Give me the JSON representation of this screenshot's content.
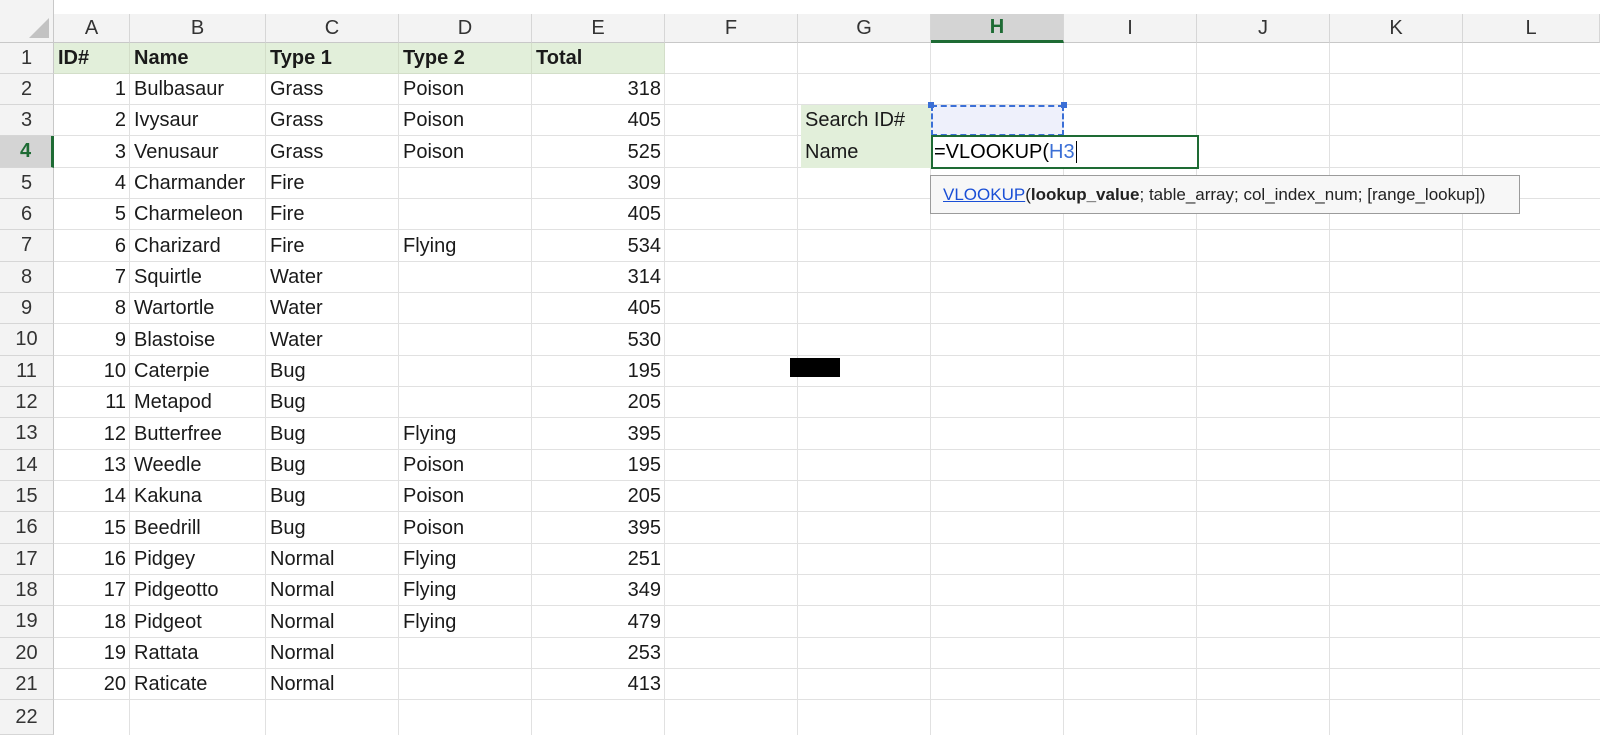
{
  "columns": [
    "A",
    "B",
    "C",
    "D",
    "E",
    "F",
    "G",
    "H",
    "I",
    "J",
    "K",
    "L"
  ],
  "rows": [
    "1",
    "2",
    "3",
    "4",
    "5",
    "6",
    "7",
    "8",
    "9",
    "10",
    "11",
    "12",
    "13",
    "14",
    "15",
    "16",
    "17",
    "18",
    "19",
    "20",
    "21",
    "22"
  ],
  "table": {
    "headers": [
      "ID#",
      "Name",
      "Type 1",
      "Type 2",
      "Total"
    ],
    "records": [
      [
        "1",
        "Bulbasaur",
        "Grass",
        "Poison",
        "318"
      ],
      [
        "2",
        "Ivysaur",
        "Grass",
        "Poison",
        "405"
      ],
      [
        "3",
        "Venusaur",
        "Grass",
        "Poison",
        "525"
      ],
      [
        "4",
        "Charmander",
        "Fire",
        "",
        "309"
      ],
      [
        "5",
        "Charmeleon",
        "Fire",
        "",
        "405"
      ],
      [
        "6",
        "Charizard",
        "Fire",
        "Flying",
        "534"
      ],
      [
        "7",
        "Squirtle",
        "Water",
        "",
        "314"
      ],
      [
        "8",
        "Wartortle",
        "Water",
        "",
        "405"
      ],
      [
        "9",
        "Blastoise",
        "Water",
        "",
        "530"
      ],
      [
        "10",
        "Caterpie",
        "Bug",
        "",
        "195"
      ],
      [
        "11",
        "Metapod",
        "Bug",
        "",
        "205"
      ],
      [
        "12",
        "Butterfree",
        "Bug",
        "Flying",
        "395"
      ],
      [
        "13",
        "Weedle",
        "Bug",
        "Poison",
        "195"
      ],
      [
        "14",
        "Kakuna",
        "Bug",
        "Poison",
        "205"
      ],
      [
        "15",
        "Beedrill",
        "Bug",
        "Poison",
        "395"
      ],
      [
        "16",
        "Pidgey",
        "Normal",
        "Flying",
        "251"
      ],
      [
        "17",
        "Pidgeotto",
        "Normal",
        "Flying",
        "349"
      ],
      [
        "18",
        "Pidgeot",
        "Normal",
        "Flying",
        "479"
      ],
      [
        "19",
        "Rattata",
        "Normal",
        "",
        "253"
      ],
      [
        "20",
        "Raticate",
        "Normal",
        "",
        "413"
      ]
    ]
  },
  "lookup": {
    "search_label": "Search ID#",
    "name_label": "Name",
    "search_value": ""
  },
  "editor": {
    "formula_prefix": "=VLOOKUP(",
    "formula_ref": "H3"
  },
  "tooltip": {
    "function": "VLOOKUP",
    "open": " (",
    "arg1": "lookup_value",
    "rest": "; table_array; col_index_num; [range_lookup])"
  },
  "selection": {
    "active_column": "H",
    "active_row": "4"
  },
  "colors": {
    "header_fill": "#e2efda",
    "selection_green": "#1e6b34",
    "reference_blue": "#3b6fd6"
  }
}
